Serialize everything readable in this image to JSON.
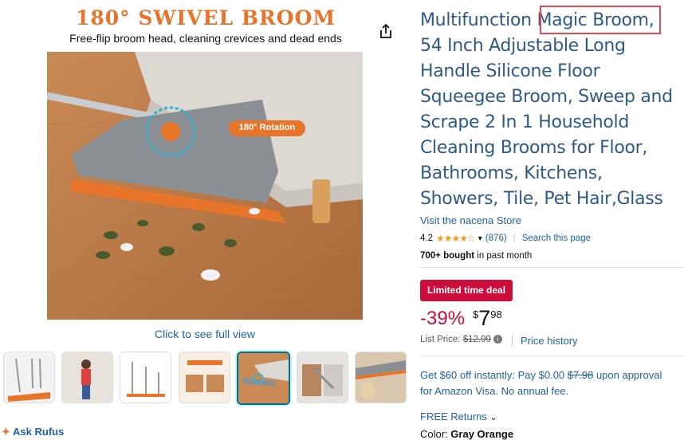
{
  "gallery": {
    "hero_title": "180° SWIVEL BROOM",
    "hero_subtitle": "Free-flip broom head, cleaning crevices and dead ends",
    "rotation_label": "180° Rotation",
    "see_full_view": "Click to see full view",
    "selected_thumb_index": 4,
    "thumb_count": 7
  },
  "rufus": {
    "label": "Ask Rufus"
  },
  "product": {
    "title_before": "Multifunction ",
    "title_highlight": "Magic Broom,",
    "title_after": " 54 Inch Adjustable Long Handle Silicone Floor Squeegee Broom, Sweep and Scrape 2 In 1 Household Cleaning Brooms for Floor, Bathrooms, Kitchens, Showers, Tile, Pet Hair,Glass",
    "store_link": "Visit the nacena Store",
    "rating": "4.2",
    "stars": "★★★★☆",
    "review_count": "(876)",
    "search_page": "Search this page",
    "bought_bold": "700+ bought",
    "bought_rest": " in past month"
  },
  "pricing": {
    "deal_badge": "Limited time deal",
    "discount": "-39%",
    "currency": "$",
    "whole": "7",
    "fraction": "98",
    "list_label": "List Price: ",
    "list_value": "$12.99",
    "price_history": "Price history"
  },
  "offer": {
    "text_start": "Get $60 off instantly: Pay $0.00 ",
    "struck": "$7.98",
    "text_end": " upon approval for Amazon Visa. No annual fee."
  },
  "returns": {
    "label": "FREE Returns"
  },
  "color": {
    "label": "Color: ",
    "value": "Gray Orange"
  },
  "colors": {
    "accent_orange": "#E8742A",
    "deal_red": "#CC0C39",
    "link_blue": "#2162A1",
    "highlight_box": "#E8474E"
  }
}
